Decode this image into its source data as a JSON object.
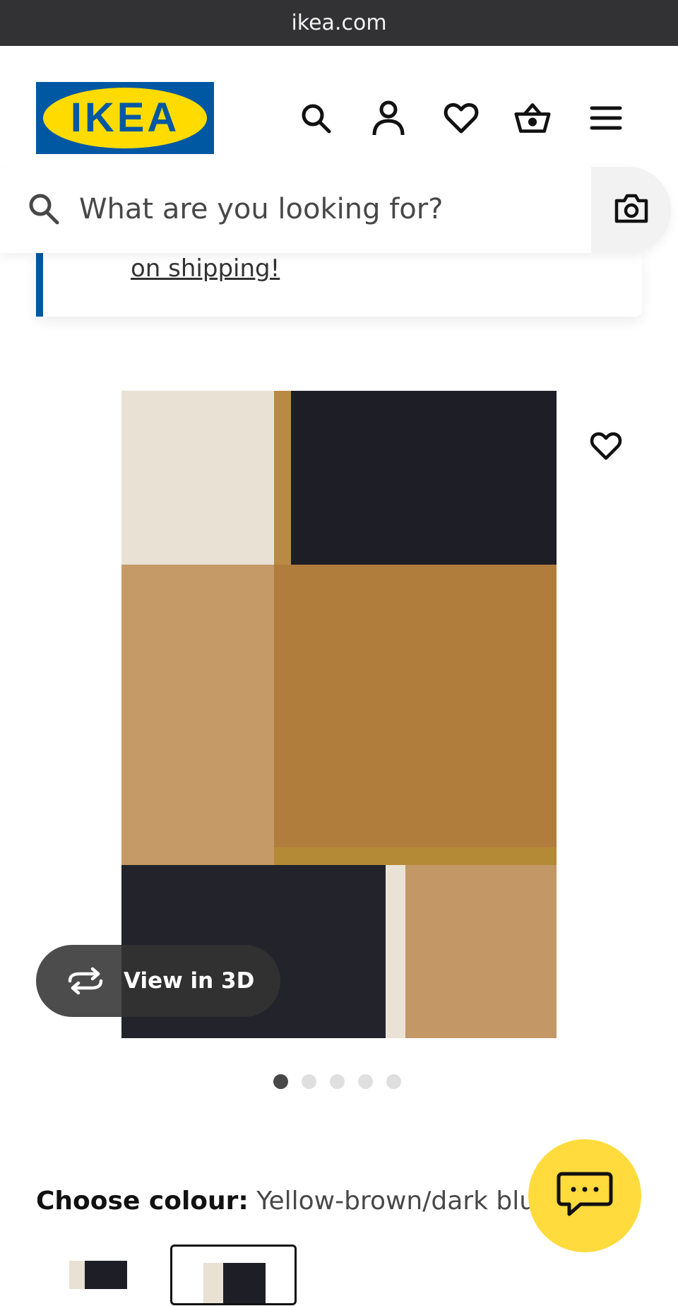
{
  "browser": {
    "url": "ikea.com"
  },
  "header": {
    "logo_text": "IKEA",
    "icons": [
      "search-icon",
      "account-icon",
      "heart-icon",
      "basket-icon",
      "menu-icon"
    ]
  },
  "search": {
    "placeholder": "What are you looking for?",
    "camera_icon": "camera-icon"
  },
  "promo": {
    "link_text": "on shipping!"
  },
  "product": {
    "gallery_dots": 5,
    "active_dot": 0,
    "view3d_label": "View in 3D",
    "rug_colors": {
      "cream": "#e8e1d4",
      "dark": "#1e1f26",
      "tan": "#c29765",
      "brown": "#b07d3c",
      "mustard": "#b58a36"
    }
  },
  "colour": {
    "label": "Choose colour:",
    "value": "Yellow-brown/dark blue"
  },
  "colors": {
    "ikea_blue": "#0058a3",
    "ikea_yellow": "#ffdb00",
    "chat_yellow": "#ffdb3d"
  }
}
